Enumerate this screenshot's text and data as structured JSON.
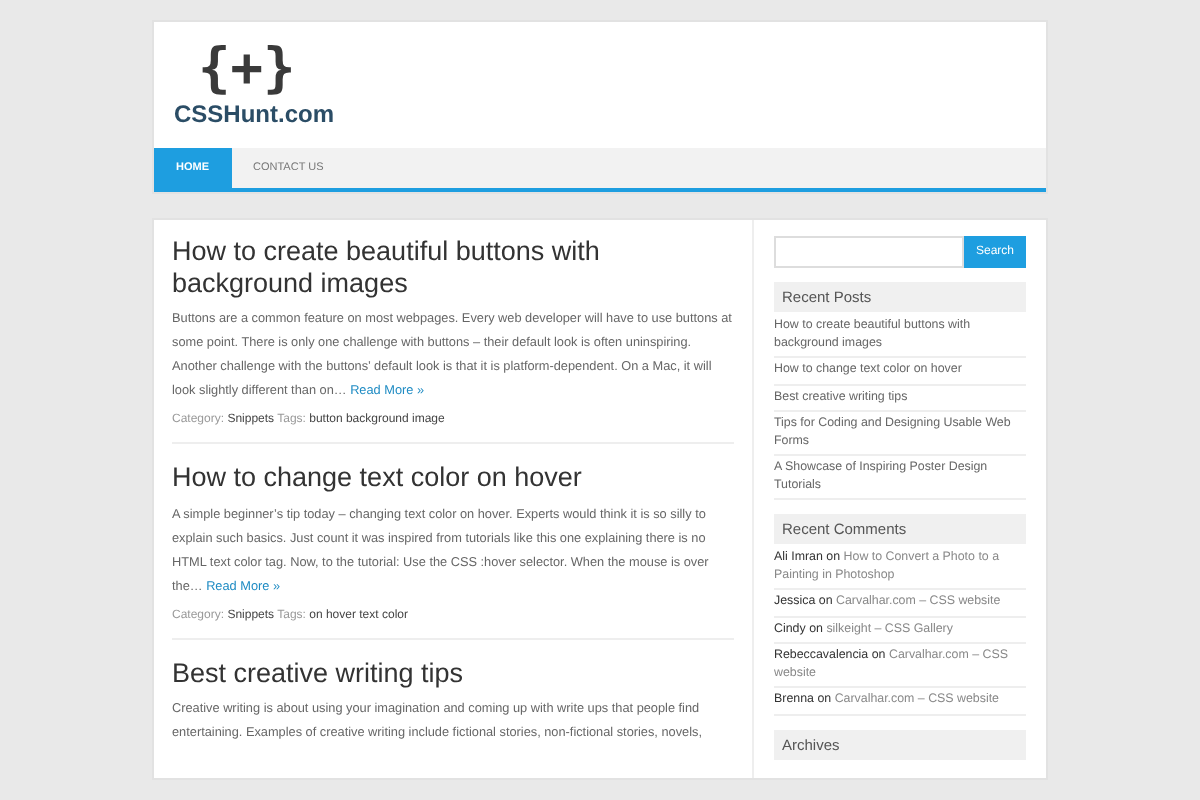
{
  "site": {
    "logo_mark": "{+}",
    "name": "CSSHunt.com"
  },
  "nav": [
    {
      "label": "HOME",
      "selected": true
    },
    {
      "label": "CONTACT US",
      "selected": false
    }
  ],
  "posts": [
    {
      "title": "How to create beautiful buttons with background images",
      "excerpt": "Buttons are a common feature on most webpages. Every web developer will have to use buttons at some point. There is only one challenge with buttons – their default look is often uninspiring. Another challenge with the buttons’ default look is that it is platform-dependent. On a Mac, it will look slightly different than on…",
      "read_more": "Read More »",
      "category_label": "Category:",
      "category": "Snippets",
      "tags_label": "Tags:",
      "tags": "button background image"
    },
    {
      "title": "How to change text color on hover",
      "excerpt": "A simple beginner’s tip today – changing text color on hover. Experts would think it is so silly to explain such basics. Just count it was inspired from tutorials like this one explaining there is no HTML text color tag. Now, to the tutorial: Use the CSS :hover selector. When the mouse is over the…",
      "read_more": "Read More »",
      "category_label": "Category:",
      "category": "Snippets",
      "tags_label": "Tags:",
      "tags": "on hover text color"
    },
    {
      "title": "Best creative writing tips",
      "excerpt": " Creative writing is about using your imagination and coming up with write ups that people find entertaining. Examples of creative writing include fictional stories, non-fictional stories, novels,"
    }
  ],
  "search": {
    "button": "Search"
  },
  "recent_posts": {
    "title": "Recent Posts",
    "items": [
      "How to create beautiful buttons with background images",
      "How to change text color on hover",
      "Best creative writing tips",
      "Tips for Coding and Designing Usable Web Forms",
      "A Showcase of Inspiring Poster Design Tutorials"
    ]
  },
  "recent_comments": {
    "title": "Recent Comments",
    "items": [
      {
        "author": "Ali Imran",
        "on": "on",
        "post": "How to Convert a Photo to a Painting in Photoshop"
      },
      {
        "author": "Jessica",
        "on": "on",
        "post": "Carvalhar.com – CSS website"
      },
      {
        "author": "Cindy",
        "on": "on",
        "post": "silkeight – CSS Gallery"
      },
      {
        "author": "Rebeccavalencia",
        "on": "on",
        "post": "Carvalhar.com – CSS website"
      },
      {
        "author": "Brenna",
        "on": "on",
        "post": "Carvalhar.com – CSS website"
      }
    ]
  },
  "archives": {
    "title": "Archives"
  }
}
